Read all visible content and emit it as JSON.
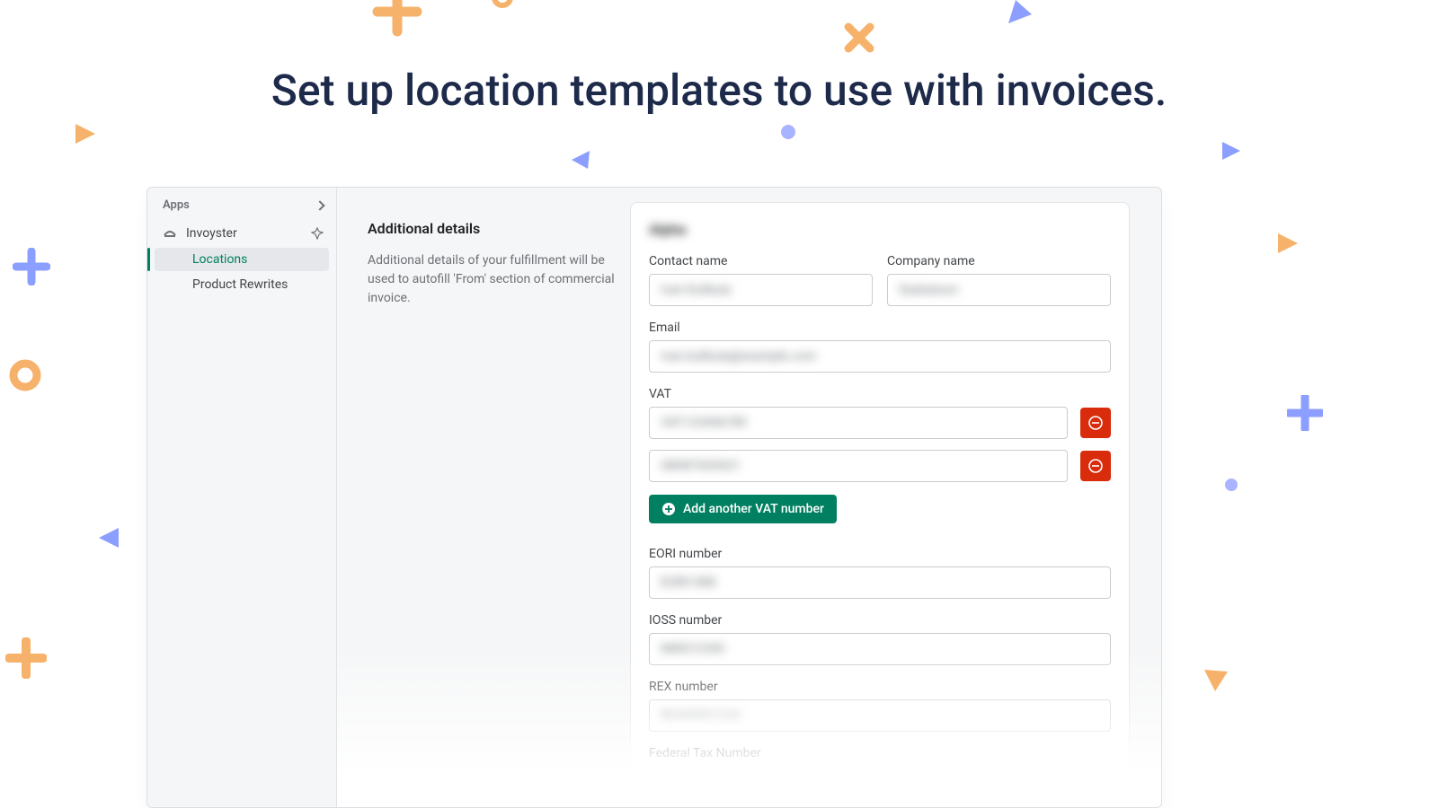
{
  "headline": "Set up location templates to use with invoices.",
  "sidebar": {
    "apps_label": "Apps",
    "app_name": "Invoyster",
    "subitems": [
      {
        "label": "Locations",
        "active": true
      },
      {
        "label": "Product Rewrites",
        "active": false
      }
    ]
  },
  "description": {
    "title": "Additional details",
    "body": "Additional details of your fulfillment will be used to autofill 'From' section of commercial invoice."
  },
  "form": {
    "card_title": "Alpha",
    "contact_name_label": "Contact name",
    "contact_name_value": "Ivan Kulikula",
    "company_name_label": "Company name",
    "company_name_value": "Saskatoon",
    "email_label": "Email",
    "email_value": "ivan.kulikula@example.com",
    "vat_label": "VAT",
    "vat_values": [
      "VAT123456789",
      "GB987654321"
    ],
    "add_vat_label": "Add another VAT number",
    "eori_label": "EORI number",
    "eori_value": "EORI1488",
    "ioss_label": "IOSS number",
    "ioss_value": "IM0012345",
    "rex_label": "REX number",
    "rex_value": "REX00001234",
    "federal_label": "Federal Tax Number"
  },
  "colors": {
    "accent_green": "#008060",
    "danger": "#d82c0d",
    "heading": "#1e2a4a"
  }
}
